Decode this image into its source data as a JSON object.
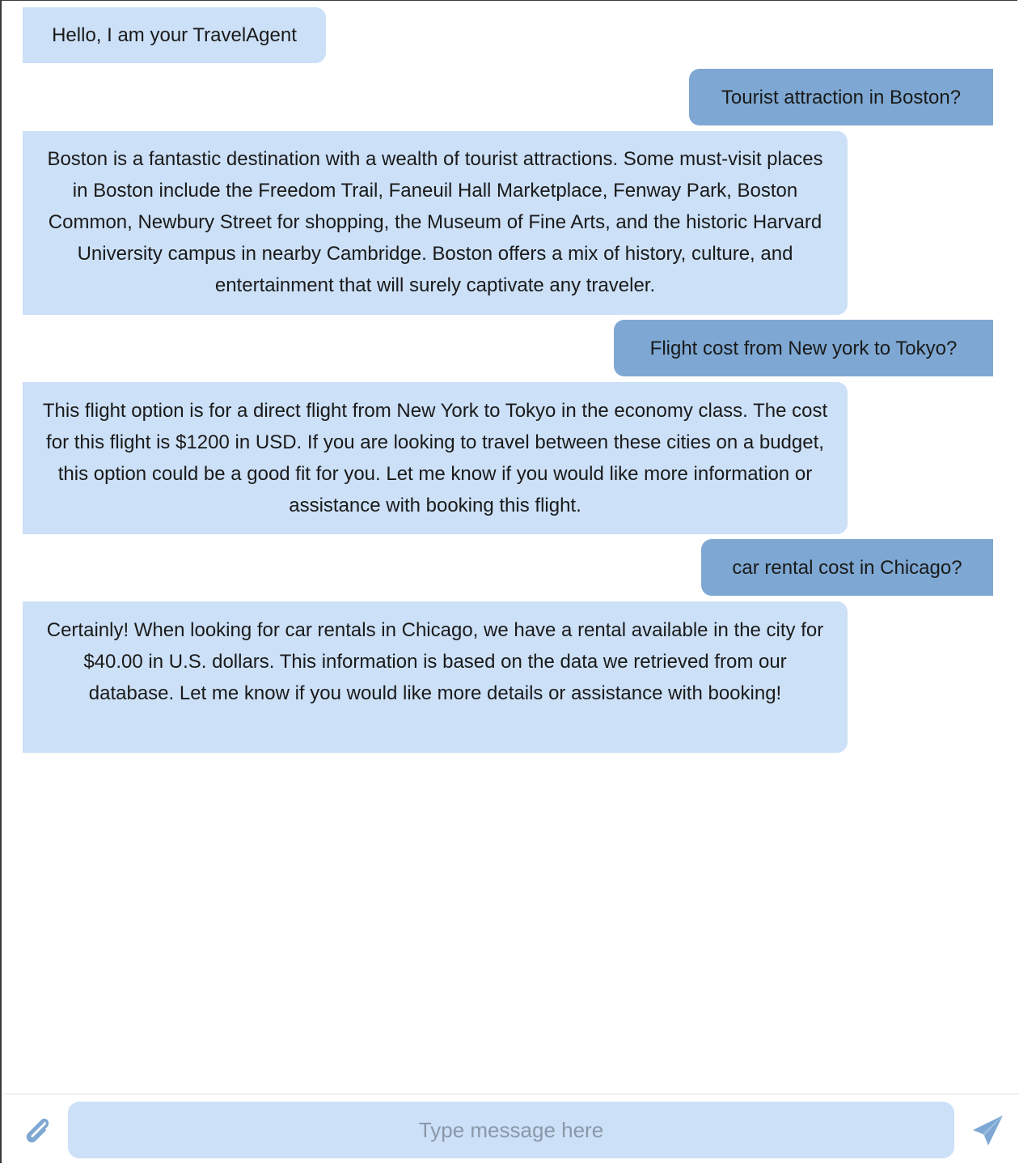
{
  "messages": [
    {
      "role": "bot",
      "text": "Hello, I am your TravelAgent"
    },
    {
      "role": "user",
      "text": "Tourist attraction in Boston?"
    },
    {
      "role": "bot",
      "text": "Boston is a fantastic destination with a wealth of tourist attractions. Some must-visit places in Boston include the Freedom Trail, Faneuil Hall Marketplace, Fenway Park, Boston Common, Newbury Street for shopping, the Museum of Fine Arts, and the historic Harvard University campus in nearby Cambridge. Boston offers a mix of history, culture, and entertainment that will surely captivate any traveler."
    },
    {
      "role": "user",
      "text": "Flight cost from New york to Tokyo?"
    },
    {
      "role": "bot",
      "text": "This flight option is for a direct flight from New York to Tokyo in the economy class. The cost for this flight is $1200 in USD. If you are looking to travel between these cities on a budget, this option could be a good fit for you. Let me know if you would like more information or assistance with booking this flight."
    },
    {
      "role": "user",
      "text": "car rental cost in Chicago?"
    },
    {
      "role": "bot",
      "text": "Certainly! When looking for car rentals in Chicago, we have a rental available in the city for $40.00 in U.S. dollars. This information is based on the data we retrieved from our database. Let me know if you would like more details or assistance with booking!"
    }
  ],
  "composer": {
    "placeholder": "Type message here",
    "value": "",
    "attach_icon": "paperclip-icon",
    "send_icon": "paper-plane-icon"
  },
  "colors": {
    "bot_bubble": "#cce0f7",
    "user_bubble": "#7ea8d3",
    "icon": "#7ea8d3",
    "input_background": "#cce0f7"
  }
}
